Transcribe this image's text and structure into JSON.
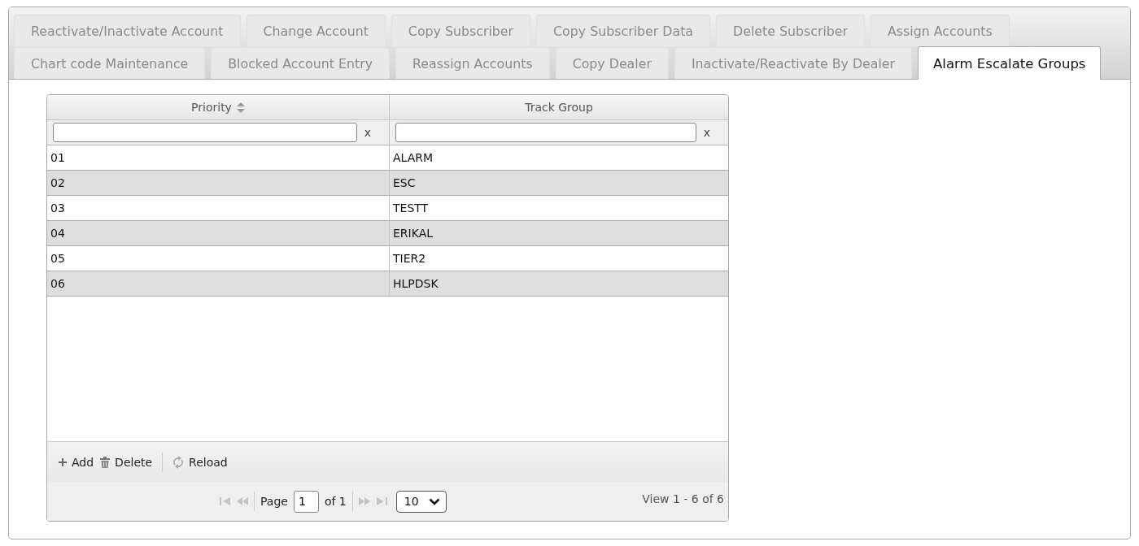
{
  "tab_rows": [
    {
      "tabs": [
        {
          "label": "Reactivate/Inactivate Account",
          "selected": false
        },
        {
          "label": "Change Account",
          "selected": false
        },
        {
          "label": "Copy Subscriber",
          "selected": false
        },
        {
          "label": "Copy Subscriber Data",
          "selected": false
        },
        {
          "label": "Delete Subscriber",
          "selected": false
        },
        {
          "label": "Assign Accounts",
          "selected": false
        }
      ]
    },
    {
      "tabs": [
        {
          "label": "Chart code Maintenance",
          "selected": false
        },
        {
          "label": "Blocked Account Entry",
          "selected": false
        },
        {
          "label": "Reassign Accounts",
          "selected": false
        },
        {
          "label": "Copy Dealer",
          "selected": false
        },
        {
          "label": "Inactivate/Reactivate By Dealer",
          "selected": false
        },
        {
          "label": "Alarm Escalate Groups",
          "selected": true
        }
      ]
    }
  ],
  "grid": {
    "columns": [
      {
        "label": "Priority",
        "sorted": true
      },
      {
        "label": "Track Group",
        "sorted": false
      }
    ],
    "filters": [
      {
        "clear": "x"
      },
      {
        "clear": "x"
      }
    ],
    "rows": [
      {
        "cells": [
          "01",
          "ALARM"
        ]
      },
      {
        "cells": [
          "02",
          "ESC"
        ]
      },
      {
        "cells": [
          "03",
          "TESTT"
        ]
      },
      {
        "cells": [
          "04",
          "ERIKAL"
        ]
      },
      {
        "cells": [
          "05",
          "TIER2"
        ]
      },
      {
        "cells": [
          "06",
          "HLPDSK"
        ]
      }
    ],
    "toolbar_groups": [
      {
        "buttons": [
          {
            "kind": "add",
            "label": "Add"
          },
          {
            "kind": "delete",
            "label": "Delete"
          }
        ]
      },
      {
        "buttons": [
          {
            "kind": "reload",
            "label": "Reload"
          }
        ]
      }
    ],
    "pager": {
      "nav_before": [
        {
          "kind": "first",
          "disabled": true
        },
        {
          "kind": "prev",
          "disabled": true
        }
      ],
      "page_label": "Page",
      "page": "1",
      "page_total": "of 1",
      "nav_after": [
        {
          "kind": "next",
          "disabled": true
        },
        {
          "kind": "last",
          "disabled": true
        }
      ],
      "page_size": "10",
      "summary": "View 1 - 6 of 6"
    }
  }
}
